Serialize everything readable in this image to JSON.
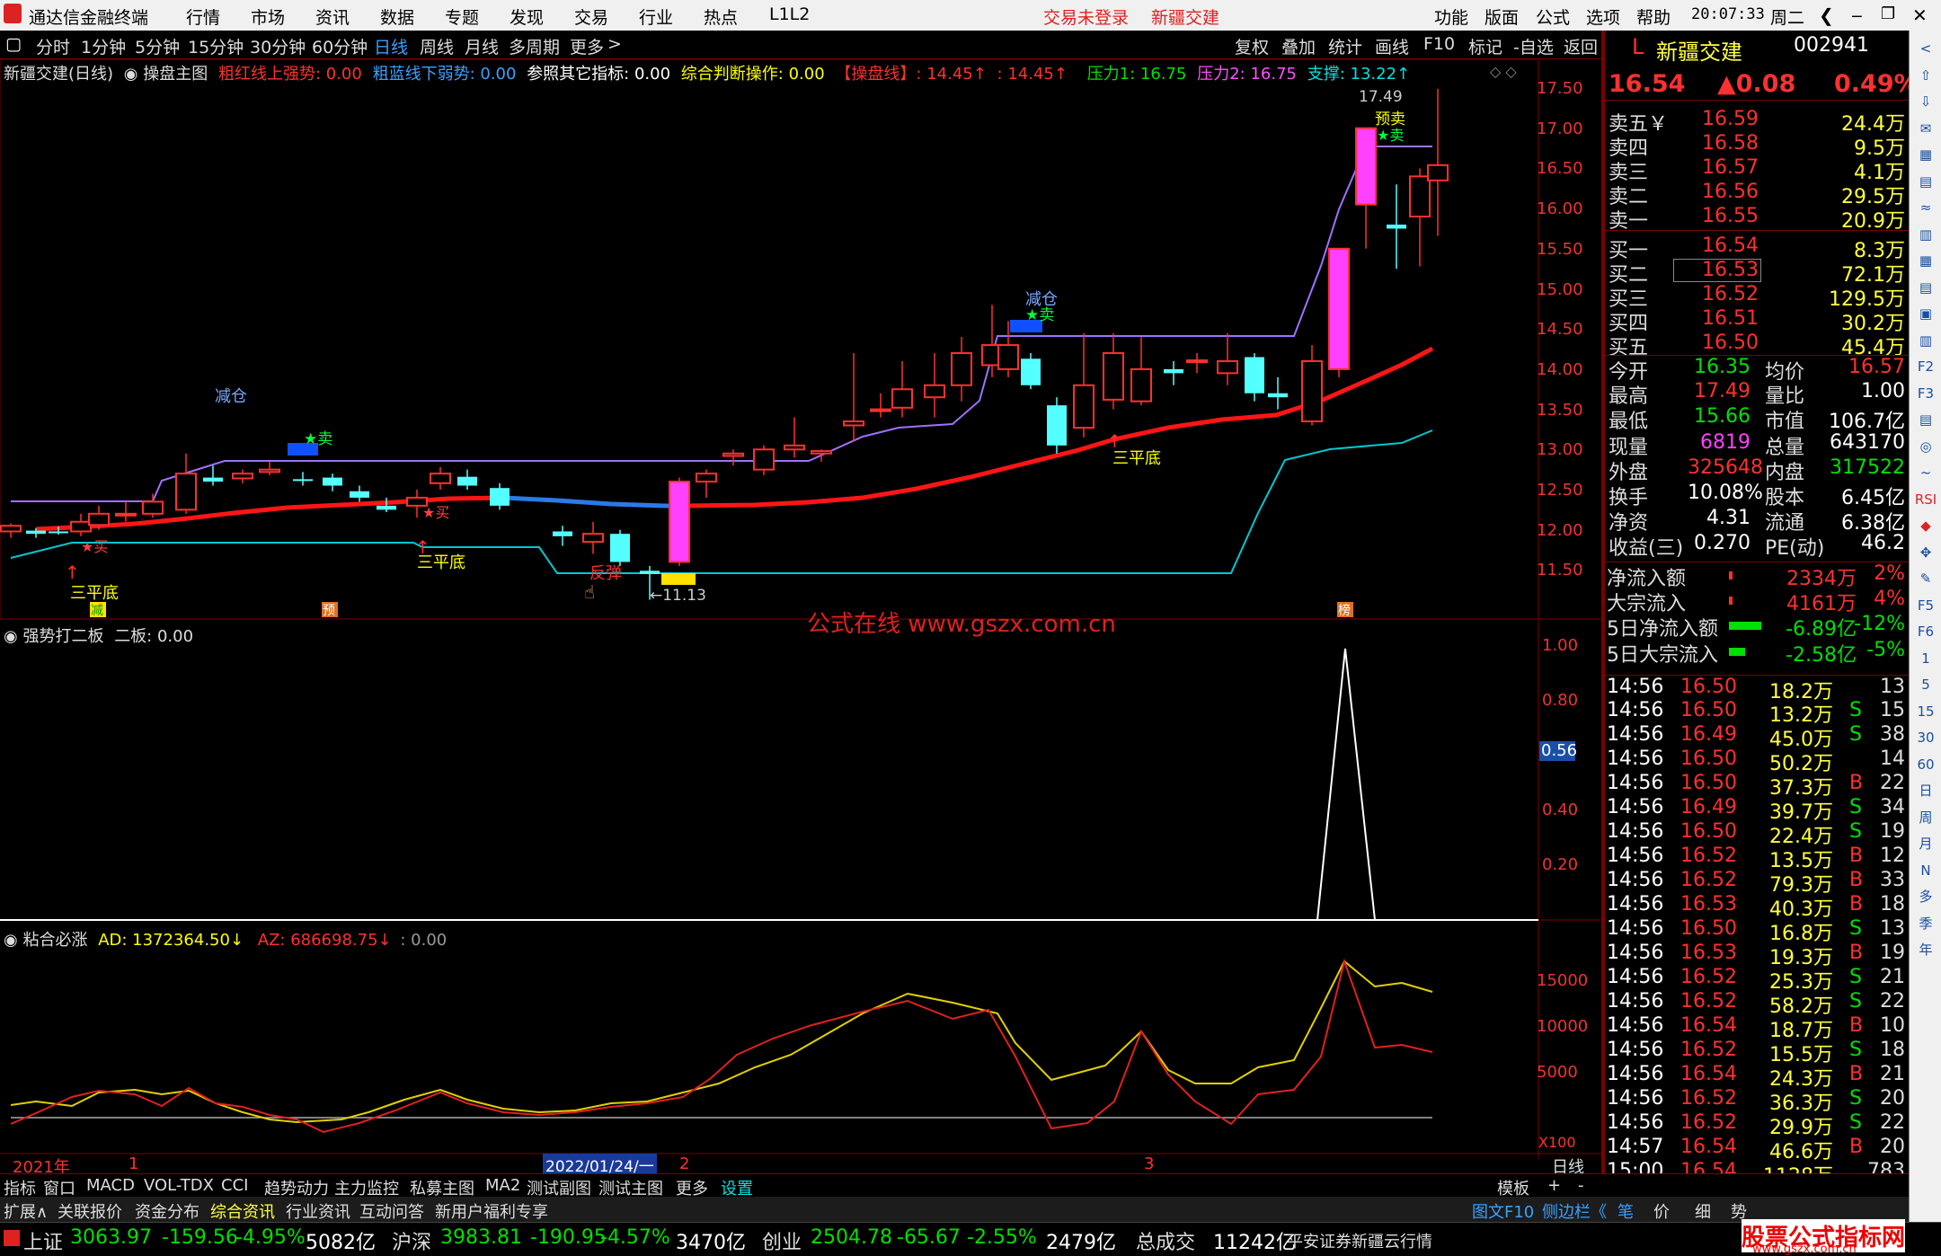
{
  "app": {
    "title": "通达信金融终端",
    "menus": [
      "行情",
      "市场",
      "资讯",
      "数据",
      "专题",
      "发现",
      "交易",
      "行业",
      "热点",
      "L1L2"
    ],
    "login": "交易未登录",
    "stock_tab": "新疆交建",
    "right_menus": [
      "功能",
      "版面",
      "公式",
      "选项",
      "帮助"
    ],
    "time": "20:07:33",
    "weekday": "周二"
  },
  "toolbar": {
    "periods": [
      "分时",
      "1分钟",
      "5分钟",
      "15分钟",
      "30分钟",
      "60分钟",
      "日线",
      "周线",
      "月线",
      "多周期",
      "更多"
    ],
    "more_arrow": ">",
    "tools": [
      "复权",
      "叠加",
      "统计",
      "画线",
      "F10",
      "标记",
      "-自选",
      "返回"
    ]
  },
  "main_chart": {
    "stock_label": "新疆交建(日线)",
    "indicator": "操盘主图",
    "legend": [
      {
        "t": "粗红线上强势: 0.00",
        "c": "#ff3030"
      },
      {
        "t": "粗蓝线下弱势: 0.00",
        "c": "#3aa0ff"
      },
      {
        "t": "参照其它指标: 0.00",
        "c": "#ffffff"
      },
      {
        "t": "综合判断操作: 0.00",
        "c": "#ffff00"
      },
      {
        "t": "【操盘线】: 14.45↑",
        "c": "#ff3030"
      },
      {
        "t": ": 14.45↑",
        "c": "#ff3030"
      },
      {
        "t": "压力1: 16.75",
        "c": "#00e000"
      },
      {
        "t": "压力2: 16.75",
        "c": "#ff50ff"
      },
      {
        "t": "支撑: 13.22↑",
        "c": "#00e0e0"
      }
    ],
    "y_ticks": [
      "17.50",
      "17.00",
      "16.50",
      "16.00",
      "15.50",
      "15.00",
      "14.50",
      "14.00",
      "13.50",
      "13.00",
      "12.50",
      "12.00",
      "11.50"
    ],
    "annotations": {
      "high": "17.49",
      "low": "←11.13",
      "jiancang1": "减仓",
      "jiancang2": "减仓",
      "sell": "★卖",
      "buy": "★买",
      "sanpingdi": "三平底",
      "fantan": "反弹",
      "yuke": "预卖",
      "jian": "减",
      "yu": "预",
      "bang": "榜"
    },
    "watermark": "公式在线  www.gszx.com.cn"
  },
  "panel2": {
    "title": "强势打二板",
    "legend": "二板: 0.00",
    "y_ticks": [
      "1.00",
      "0.80",
      "0.56",
      "0.40",
      "0.20"
    ]
  },
  "panel3": {
    "title": "粘合必涨",
    "ad": "AD: 1372364.50↓",
    "az": "AZ: 686698.75↓",
    "v": ": 0.00",
    "y_ticks": [
      "15000",
      "10000",
      "5000"
    ],
    "mult": "X100"
  },
  "x_axis": {
    "year": "2021年",
    "m1": "1",
    "cursor": "2022/01/24/一",
    "m2": "2",
    "m3": "3",
    "period": "日线"
  },
  "quote": {
    "flag": "L",
    "name": "新疆交建",
    "code": "002941",
    "price": "16.54",
    "change": "▲0.08",
    "pct": "0.49%",
    "asks": [
      {
        "l": "卖五￥",
        "p": "16.59",
        "v": "24.4万"
      },
      {
        "l": "卖四",
        "p": "16.58",
        "v": "9.5万"
      },
      {
        "l": "卖三",
        "p": "16.57",
        "v": "4.1万"
      },
      {
        "l": "卖二",
        "p": "16.56",
        "v": "29.5万"
      },
      {
        "l": "卖一",
        "p": "16.55",
        "v": "20.9万"
      }
    ],
    "bids": [
      {
        "l": "买一",
        "p": "16.54",
        "v": "8.3万"
      },
      {
        "l": "买二",
        "p": "16.53",
        "v": "72.1万"
      },
      {
        "l": "买三",
        "p": "16.52",
        "v": "129.5万"
      },
      {
        "l": "买四",
        "p": "16.51",
        "v": "30.2万"
      },
      {
        "l": "买五",
        "p": "16.50",
        "v": "45.4万"
      }
    ],
    "stats": [
      [
        "今开",
        "16.35",
        "均价",
        "16.57"
      ],
      [
        "最高",
        "17.49",
        "量比",
        "1.00"
      ],
      [
        "最低",
        "15.66",
        "市值",
        "106.7亿"
      ],
      [
        "现量",
        "6819",
        "总量",
        "643170"
      ],
      [
        "外盘",
        "325648",
        "内盘",
        "317522"
      ],
      [
        "换手",
        "10.08%",
        "股本",
        "6.45亿"
      ],
      [
        "净资",
        "4.31",
        "流通",
        "6.38亿"
      ],
      [
        "收益(三)",
        "0.270",
        "PE(动)",
        "46.2"
      ]
    ],
    "flows": [
      [
        "净流入额",
        "2334万",
        "2%"
      ],
      [
        "大宗流入",
        "4161万",
        "4%"
      ],
      [
        "5日净流入额",
        "-6.89亿",
        "-12%"
      ],
      [
        "5日大宗流入",
        "-2.58亿",
        "-5%"
      ]
    ],
    "ticks": [
      [
        "14:56",
        "16.50",
        "18.2万",
        "",
        "13"
      ],
      [
        "14:56",
        "16.50",
        "13.2万",
        "S",
        "15"
      ],
      [
        "14:56",
        "16.49",
        "45.0万",
        "S",
        "38"
      ],
      [
        "14:56",
        "16.50",
        "50.2万",
        "",
        "14"
      ],
      [
        "14:56",
        "16.50",
        "37.3万",
        "B",
        "22"
      ],
      [
        "14:56",
        "16.49",
        "39.7万",
        "S",
        "34"
      ],
      [
        "14:56",
        "16.50",
        "22.4万",
        "S",
        "19"
      ],
      [
        "14:56",
        "16.52",
        "13.5万",
        "B",
        "12"
      ],
      [
        "14:56",
        "16.52",
        "79.3万",
        "B",
        "33"
      ],
      [
        "14:56",
        "16.53",
        "40.3万",
        "B",
        "18"
      ],
      [
        "14:56",
        "16.50",
        "16.8万",
        "S",
        "13"
      ],
      [
        "14:56",
        "16.53",
        "19.3万",
        "B",
        "19"
      ],
      [
        "14:56",
        "16.52",
        "25.3万",
        "S",
        "21"
      ],
      [
        "14:56",
        "16.52",
        "58.2万",
        "S",
        "22"
      ],
      [
        "14:56",
        "16.54",
        "18.7万",
        "B",
        "10"
      ],
      [
        "14:56",
        "16.52",
        "15.5万",
        "S",
        "18"
      ],
      [
        "14:56",
        "16.54",
        "24.3万",
        "B",
        "21"
      ],
      [
        "14:56",
        "16.52",
        "36.3万",
        "S",
        "20"
      ],
      [
        "14:56",
        "16.52",
        "29.9万",
        "S",
        "22"
      ],
      [
        "14:57",
        "16.54",
        "46.6万",
        "B",
        "20"
      ],
      [
        "15:00",
        "16.54",
        "1128万",
        "",
        "783"
      ]
    ]
  },
  "bottom_tabs": [
    "指标",
    "窗口",
    "MACD",
    "VOL-TDX",
    "CCI",
    "趋势动力",
    "主力监控",
    "私募主图",
    "MA2",
    "测试副图",
    "测试主图",
    "更多",
    "设置"
  ],
  "bottom_tabs_right": [
    "模板",
    "+",
    "-"
  ],
  "bottom_row2": [
    "扩展∧",
    "关联报价",
    "资金分布",
    "综合资讯",
    "行业资讯",
    "互动问答",
    "新用户福利专享"
  ],
  "bottom_row2_right": [
    "图文F10",
    "侧边栏《",
    "笔",
    "价",
    "细",
    "势"
  ],
  "status": {
    "sh": "上证",
    "sh_v": "3063.97",
    "sh_c": "-159.56",
    "sh_p": "-4.95%",
    "sh_a": "5082亿",
    "hs": "沪深",
    "hs_v": "3983.81",
    "hs_c": "-190.95",
    "hs_p": "-4.57%",
    "hs_a": "3470亿",
    "cy": "创业",
    "cy_v": "2504.78",
    "cy_c": "-65.67",
    "cy_p": "-2.55%",
    "cy_a": "2479亿",
    "tot": "总成交",
    "tot_v": "11242亿",
    "broker": "平安证券新疆云行情",
    "logo1": "股票公式指标网",
    "logo2": "www.gszx.com.cn"
  },
  "sidebar_icons": [
    "<",
    "⇧",
    "⇩",
    "✉",
    "▦",
    "▤",
    "≈",
    "▥",
    "▦",
    "▤",
    "▣",
    "▥",
    "F2",
    "F3",
    "▤",
    "◎",
    "~",
    "RSI",
    "◆",
    "✥",
    "✎",
    "F5",
    "F6",
    "1",
    "5",
    "15",
    "30",
    "60",
    "日",
    "周",
    "月",
    "N",
    "多",
    "季",
    "年"
  ]
}
